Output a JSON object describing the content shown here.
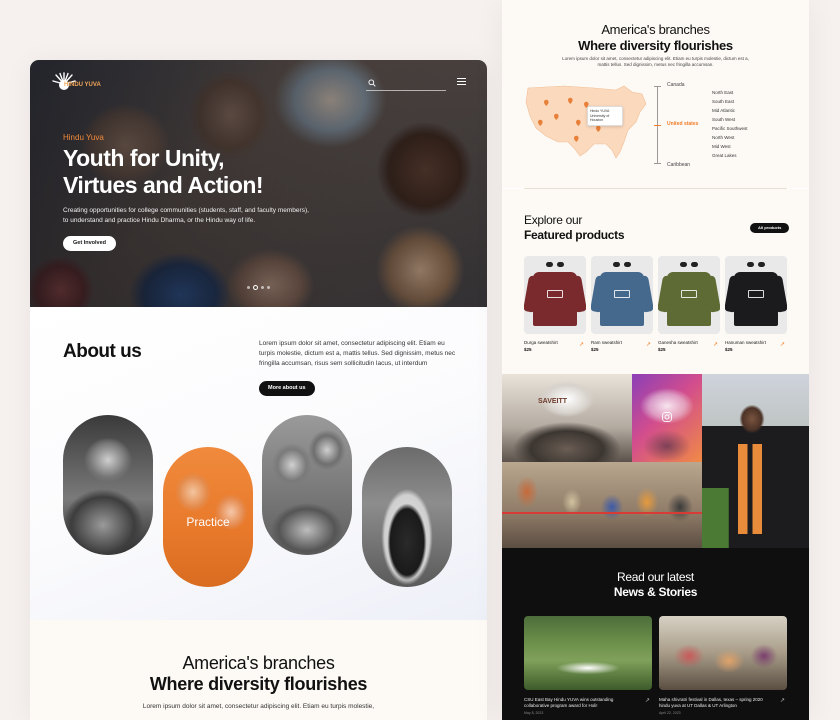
{
  "colors": {
    "accent": "#f07c28",
    "dark": "#111111",
    "cream": "#fdfaf5"
  },
  "left_page": {
    "header": {
      "logo_text": "HINDU YUVA",
      "icons": [
        "search-icon",
        "hamburger-menu-icon"
      ]
    },
    "hero": {
      "eyebrow": "Hindu Yuva",
      "title_light": "Youth for ",
      "title_bold_1": "Unity,",
      "title_bold_2": "Virtues and Action!",
      "description": "Creating opportunities for college communities (students, staff, and faculty members), to understand and practice Hindu Dharma, or the Hindu way of life.",
      "cta_label": "Get Involved"
    },
    "about": {
      "title": "About us",
      "text": "Lorem ipsum dolor sit amet, consectetur adipiscing elit. Etiam eu turpis molestie, dictum est a, mattis tellus. Sed dignissim, metus nec fringilla accumsan, risus sem sollicitudin lacus, ut interdum",
      "cta_label": "More about us",
      "pill_label": "Practice"
    },
    "branches": {
      "line1": "America's branches",
      "line2": "Where diversity flourishes",
      "text": "Lorem ipsum dolor sit amet, consectetur adipiscing elit. Etiam eu turpis molestie,"
    }
  },
  "right_page": {
    "branches": {
      "line1": "America's branches",
      "line2": "Where diversity flourishes",
      "text": "Lorem ipsum dolor sit amet, consectetur adipiscing elit. Etiam eu turpis molestie, dictum est a, mattis tellus. Sed dignissim, metus nec fringilla accumsan.",
      "map_tooltip": "Hindu YUVA University of Houston",
      "axis": [
        "Canada",
        "United states",
        "Caribbean"
      ],
      "regions": [
        "North East",
        "South East",
        "Mid Atlantic",
        "South West",
        "Pacific Southwest",
        "North West",
        "Mid West",
        "Great Lakes"
      ]
    },
    "products": {
      "line1": "Explore our",
      "line2": "Featured products",
      "all_label": "All products",
      "items": [
        {
          "name": "Durga sweatshirt",
          "price": "$25",
          "color": "#7a2a2c"
        },
        {
          "name": "Ram sweatshirt",
          "price": "$25",
          "color": "#45698d"
        },
        {
          "name": "Ganesha sweatshirt",
          "price": "$25",
          "color": "#5f6b34"
        },
        {
          "name": "Hanuman sweatshirt",
          "price": "$25",
          "color": "#1b1b1d"
        }
      ]
    },
    "gallery": {
      "banner_text": "SAVEITT"
    },
    "news": {
      "line1": "Read our latest",
      "line2": "News & Stories",
      "items": [
        {
          "title": "CSU East Bay Hindu YUVA wins outstanding collaborative program award for Holi!",
          "date": "May 8, 2023"
        },
        {
          "title": "Maha shivratri festival in Dallas, texas – spring 2020 hindu yuva at UT Dallas & UT Arlington",
          "date": "April 22, 2023"
        }
      ]
    }
  }
}
